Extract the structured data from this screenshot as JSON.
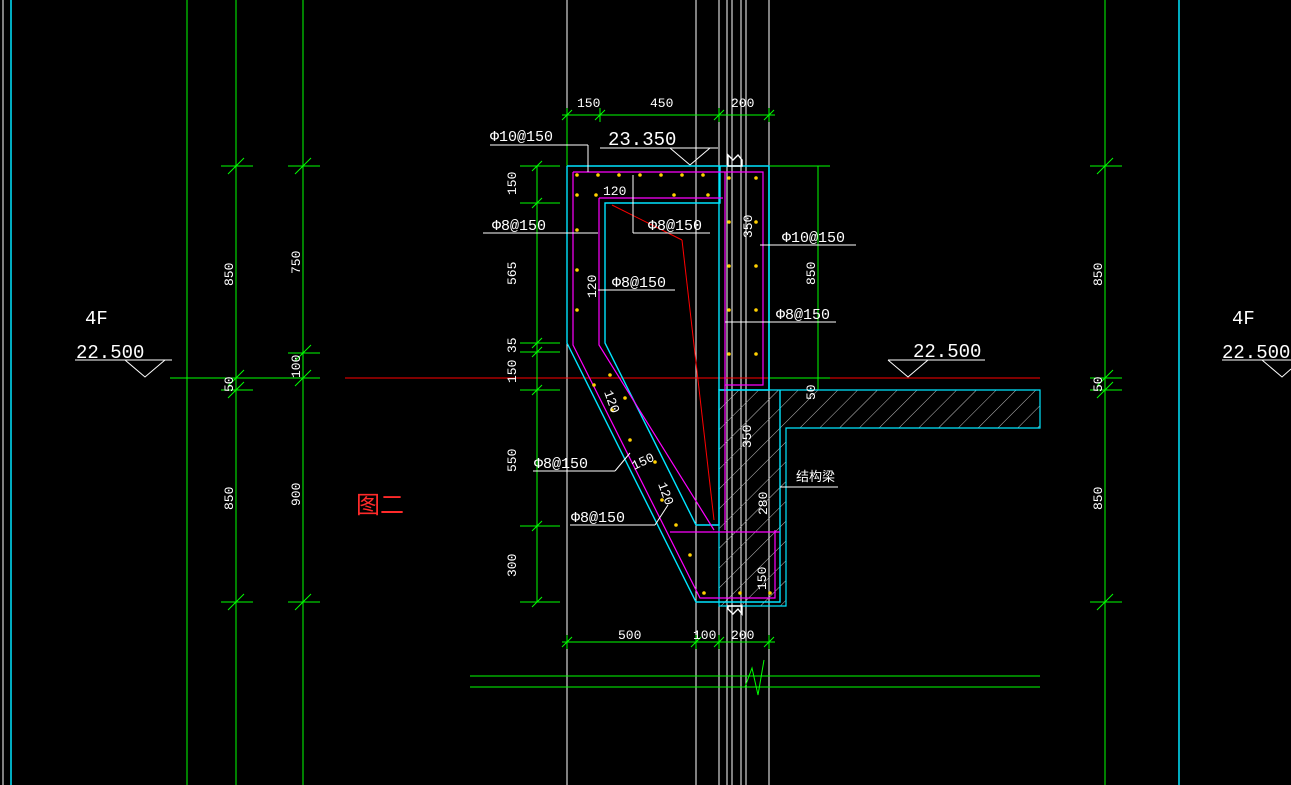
{
  "figure_label": "图二",
  "floor_label": "4F",
  "elevations": {
    "floor_left": "22.500",
    "floor_mid": "22.500",
    "floor_right": "22.500",
    "top": "23.350"
  },
  "top_dims": [
    "150",
    "450",
    "200"
  ],
  "bottom_dims": [
    "500",
    "100",
    "200"
  ],
  "left_dims": [
    "150",
    "565",
    "35",
    "150",
    "550",
    "300"
  ],
  "col_dims_a": [
    "850",
    "50",
    "850"
  ],
  "col_dims_b": [
    "750",
    "100",
    "900"
  ],
  "right_inner_dims": [
    "350",
    "850",
    "50"
  ],
  "right_col_dims": [
    "850",
    "50",
    "850"
  ],
  "section_dims": {
    "d120a": "120",
    "d120b": "120",
    "d120c": "120",
    "d120d": "120",
    "d150": "150",
    "d350b": "350",
    "d280": "280",
    "d150b": "150"
  },
  "rebar": {
    "r1": "Φ10@150",
    "r2": "Φ8@150",
    "r3": "Φ8@150",
    "r4": "Φ8@150",
    "r5": "Φ10@150",
    "r6": "Φ8@150",
    "r7": "Φ8@150",
    "r8": "Φ8@150"
  },
  "beam_label": "结构梁",
  "colors": {
    "background": "#000000",
    "grid": "#00ff00",
    "axis": "#ffffff",
    "concrete": "#00e5ff",
    "rebar": "#ff00ff",
    "centerline": "#ff0000",
    "text": "#ffffff",
    "label": "#ff2a2a"
  }
}
